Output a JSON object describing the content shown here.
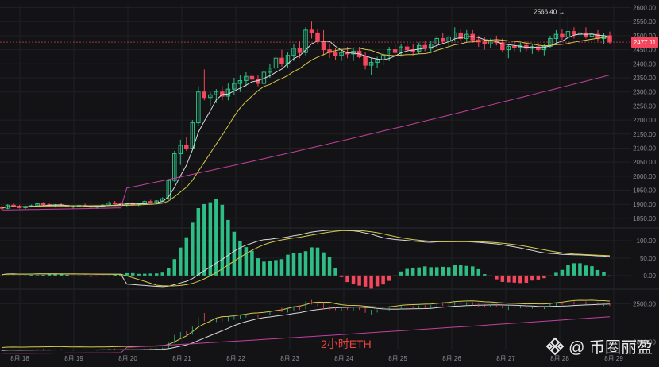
{
  "caption": "2小时ETH",
  "watermark": "@ 币圈丽盈",
  "colors": {
    "background": "#131316",
    "up": "#2ebd85",
    "down": "#f6465d",
    "ma_fast": "#d9d9d9",
    "ma_mid": "#d6c94a",
    "ma_slow": "#c2409c",
    "grid": "#1f2026",
    "axis_text": "#8a8d93",
    "last_price_tag": "#f6465d"
  },
  "chart_data": [
    {
      "type": "candlestick",
      "pane": "price",
      "x": [
        "8月 18",
        "8月 19",
        "8月 20",
        "8月 21",
        "8月 22",
        "8月 23",
        "8月 24",
        "8月 25",
        "8月 26",
        "8月 27",
        "8月 28",
        "8月 29"
      ],
      "y_ticks": [
        2600,
        2550,
        2500,
        2450,
        2400,
        2350,
        2300,
        2250,
        2200,
        2150,
        2100,
        2050,
        2000,
        1950,
        1900,
        1850
      ],
      "ylim": [
        1830,
        2610
      ],
      "high_marker": {
        "label": "2566.40 →",
        "value": 2566.4
      },
      "last_price": {
        "label": "2477.11",
        "value": 2477.11
      },
      "candles": [
        [
          1890,
          1894,
          1880,
          1886
        ],
        [
          1886,
          1900,
          1883,
          1897
        ],
        [
          1897,
          1903,
          1890,
          1893
        ],
        [
          1893,
          1898,
          1885,
          1888
        ],
        [
          1888,
          1895,
          1884,
          1892
        ],
        [
          1892,
          1899,
          1889,
          1895
        ],
        [
          1895,
          1906,
          1892,
          1902
        ],
        [
          1902,
          1908,
          1896,
          1899
        ],
        [
          1899,
          1903,
          1892,
          1895
        ],
        [
          1895,
          1901,
          1889,
          1898
        ],
        [
          1898,
          1904,
          1893,
          1896
        ],
        [
          1896,
          1900,
          1888,
          1891
        ],
        [
          1891,
          1897,
          1885,
          1894
        ],
        [
          1894,
          1899,
          1890,
          1896
        ],
        [
          1896,
          1902,
          1891,
          1893
        ],
        [
          1893,
          1898,
          1886,
          1890
        ],
        [
          1890,
          1896,
          1884,
          1893
        ],
        [
          1893,
          1900,
          1889,
          1897
        ],
        [
          1897,
          1910,
          1894,
          1905
        ],
        [
          1905,
          1912,
          1899,
          1902
        ],
        [
          1902,
          1908,
          1896,
          1900
        ],
        [
          1900,
          1906,
          1893,
          1903
        ],
        [
          1903,
          1909,
          1897,
          1899
        ],
        [
          1899,
          1905,
          1894,
          1902
        ],
        [
          1902,
          1915,
          1898,
          1910
        ],
        [
          1910,
          1916,
          1903,
          1906
        ],
        [
          1906,
          1915,
          1902,
          1912
        ],
        [
          1912,
          1925,
          1908,
          1920
        ],
        [
          1920,
          1990,
          1916,
          1985
        ],
        [
          1985,
          2090,
          1980,
          2080
        ],
        [
          2080,
          2130,
          2040,
          2110
        ],
        [
          2110,
          2140,
          2090,
          2100
        ],
        [
          2100,
          2200,
          2095,
          2190
        ],
        [
          2190,
          2320,
          2180,
          2300
        ],
        [
          2300,
          2380,
          2270,
          2280
        ],
        [
          2280,
          2300,
          2250,
          2290
        ],
        [
          2290,
          2310,
          2260,
          2300
        ],
        [
          2300,
          2320,
          2270,
          2285
        ],
        [
          2285,
          2330,
          2270,
          2310
        ],
        [
          2310,
          2350,
          2290,
          2330
        ],
        [
          2330,
          2360,
          2300,
          2340
        ],
        [
          2340,
          2370,
          2320,
          2355
        ],
        [
          2355,
          2365,
          2330,
          2345
        ],
        [
          2345,
          2360,
          2320,
          2330
        ],
        [
          2330,
          2380,
          2320,
          2370
        ],
        [
          2370,
          2400,
          2350,
          2385
        ],
        [
          2385,
          2430,
          2370,
          2420
        ],
        [
          2420,
          2450,
          2390,
          2400
        ],
        [
          2400,
          2440,
          2385,
          2430
        ],
        [
          2430,
          2470,
          2410,
          2455
        ],
        [
          2455,
          2480,
          2420,
          2440
        ],
        [
          2440,
          2530,
          2430,
          2520
        ],
        [
          2520,
          2550,
          2490,
          2510
        ],
        [
          2510,
          2525,
          2470,
          2480
        ],
        [
          2480,
          2520,
          2430,
          2450
        ],
        [
          2450,
          2470,
          2420,
          2440
        ],
        [
          2440,
          2455,
          2415,
          2430
        ],
        [
          2430,
          2450,
          2410,
          2440
        ],
        [
          2440,
          2460,
          2420,
          2435
        ],
        [
          2435,
          2455,
          2410,
          2445
        ],
        [
          2445,
          2460,
          2420,
          2425
        ],
        [
          2425,
          2440,
          2380,
          2395
        ],
        [
          2395,
          2420,
          2360,
          2405
        ],
        [
          2405,
          2425,
          2385,
          2415
        ],
        [
          2415,
          2440,
          2395,
          2430
        ],
        [
          2430,
          2460,
          2410,
          2450
        ],
        [
          2450,
          2470,
          2425,
          2440
        ],
        [
          2440,
          2470,
          2425,
          2460
        ],
        [
          2460,
          2480,
          2440,
          2450
        ],
        [
          2450,
          2470,
          2430,
          2445
        ],
        [
          2445,
          2475,
          2435,
          2465
        ],
        [
          2465,
          2480,
          2445,
          2455
        ],
        [
          2455,
          2480,
          2440,
          2470
        ],
        [
          2470,
          2500,
          2455,
          2490
        ],
        [
          2490,
          2510,
          2470,
          2480
        ],
        [
          2480,
          2500,
          2460,
          2495
        ],
        [
          2495,
          2530,
          2480,
          2510
        ],
        [
          2510,
          2525,
          2480,
          2490
        ],
        [
          2490,
          2520,
          2475,
          2505
        ],
        [
          2505,
          2520,
          2475,
          2485
        ],
        [
          2485,
          2500,
          2460,
          2478
        ],
        [
          2478,
          2495,
          2450,
          2470
        ],
        [
          2470,
          2490,
          2455,
          2482
        ],
        [
          2482,
          2500,
          2465,
          2475
        ],
        [
          2475,
          2490,
          2440,
          2450
        ],
        [
          2450,
          2470,
          2420,
          2462
        ],
        [
          2462,
          2480,
          2445,
          2458
        ],
        [
          2458,
          2475,
          2440,
          2465
        ],
        [
          2465,
          2480,
          2445,
          2455
        ],
        [
          2455,
          2470,
          2435,
          2460
        ],
        [
          2460,
          2475,
          2440,
          2450
        ],
        [
          2450,
          2470,
          2430,
          2462
        ],
        [
          2462,
          2500,
          2455,
          2490
        ],
        [
          2490,
          2520,
          2475,
          2505
        ],
        [
          2505,
          2525,
          2485,
          2495
        ],
        [
          2495,
          2566,
          2490,
          2515
        ],
        [
          2515,
          2530,
          2490,
          2505
        ],
        [
          2505,
          2525,
          2485,
          2510
        ],
        [
          2510,
          2530,
          2490,
          2498
        ],
        [
          2498,
          2520,
          2480,
          2505
        ],
        [
          2505,
          2520,
          2480,
          2490
        ],
        [
          2490,
          2510,
          2470,
          2500
        ],
        [
          2500,
          2515,
          2470,
          2477
        ]
      ]
    },
    {
      "type": "bar",
      "pane": "macd",
      "y_ticks": [
        100,
        50,
        0
      ],
      "ylim": [
        -30,
        125
      ],
      "x_ticks": [
        "100.00",
        "50.00",
        "0.00"
      ]
    },
    {
      "type": "line",
      "pane": "indicator",
      "y_ticks": [
        2500,
        2000
      ],
      "ylim": [
        1900,
        2650
      ],
      "x_ticks": [
        "2500.00",
        "2000.00"
      ]
    }
  ],
  "x_labels": [
    "8月 18",
    "8月 19",
    "8月 20",
    "8月 21",
    "8月 22",
    "8月 23",
    "8月 24",
    "8月 25",
    "8月 26",
    "8月 27",
    "8月 28",
    "8月 29"
  ]
}
